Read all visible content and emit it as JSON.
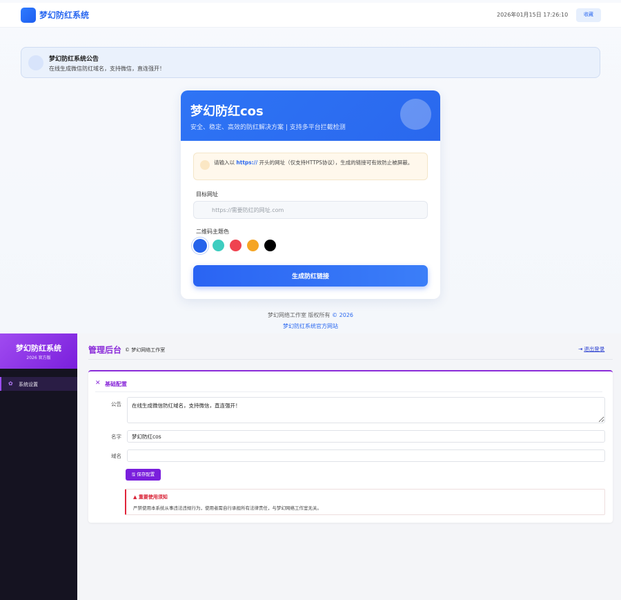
{
  "topbar": {
    "brand": "梦幻防红系统",
    "datetime": "2026年01月15日 17:26:10",
    "favorite_label": "收藏"
  },
  "notice": {
    "title": "梦幻防红系统公告",
    "text": "在线生成微信防红域名，支持微信，直连强开！"
  },
  "card": {
    "title": "梦幻防红cos",
    "subtitle": "安全、稳定、高效的防红解决方案 | 支持多平台拦截检测",
    "tip_prefix": "请输入以 ",
    "tip_highlight": "https://",
    "tip_suffix": " 开头的网址（仅支持HTTPS协议），生成的链接可有效防止被屏蔽。",
    "target_label": "目标网址",
    "url_placeholder": "https://需要防红的网址.com",
    "color_label": "二维码主题色",
    "colors": [
      "#2563eb",
      "#3ecdc0",
      "#ef4350",
      "#f5a524",
      "#000000"
    ],
    "selected_color": "#2563eb",
    "generate_label": "生成防红链接"
  },
  "footer": {
    "copyright_prefix": "梦幻网络工作室 版权所有 ",
    "copyright_year": "© 2026",
    "site_link": "梦幻防红系统官方网站"
  },
  "admin": {
    "sidebar": {
      "title": "梦幻防红系统",
      "subtitle": "2026 官方版",
      "items": [
        {
          "icon": "gear-icon",
          "label": "系统设置",
          "active": true
        }
      ]
    },
    "header": {
      "title": "管理后台",
      "copyright": "© 梦幻网络工作室",
      "logout_label": "退出登录"
    },
    "panel": {
      "title": "基础配置",
      "notice_label": "公告",
      "notice_value": "在线生成微信防红域名，支持微信，直连强开！",
      "name_label": "名字",
      "name_value": "梦幻防红cos",
      "domain_label": "域名",
      "domain_value": "",
      "save_label": "保存配置",
      "warning_title": "重要使用须知",
      "warning_text": "严禁使用本系统从事违法违规行为，使用者需自行承担所有法律责任，与梦幻网络工作室无关。"
    }
  },
  "accent_colors": {
    "blue": "#2a68f0",
    "purple": "#8a2bd9",
    "red": "#d81e32"
  }
}
